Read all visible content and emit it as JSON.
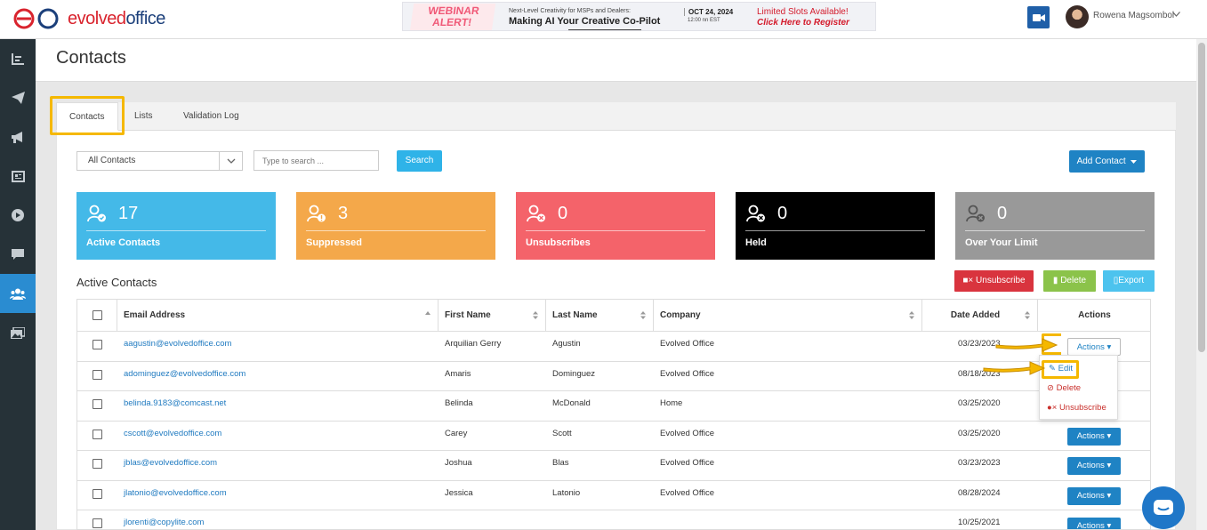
{
  "header": {
    "logo_text_1": "evolved",
    "logo_text_2": "office",
    "banner": {
      "alert_line1": "WEBINAR",
      "alert_line2": "ALERT!",
      "subtitle": "Next-Level Creativity for MSPs and Dealers:",
      "title": "Making AI Your Creative Co-Pilot",
      "date": "OCT 24, 2024",
      "time": "12:00 nn EST",
      "slots": "Limited Slots Available!",
      "cta": "Click Here to Register"
    },
    "user_name": "Rowena Magsombol"
  },
  "sidebar": {
    "items": [
      {
        "icon": "reports-icon"
      },
      {
        "icon": "paper-plane-icon"
      },
      {
        "icon": "megaphone-icon"
      },
      {
        "icon": "newspaper-icon"
      },
      {
        "icon": "play-icon"
      },
      {
        "icon": "chat-icon"
      },
      {
        "icon": "users-icon",
        "active": true
      },
      {
        "icon": "images-icon"
      }
    ]
  },
  "page": {
    "title": "Contacts",
    "tabs": [
      "Contacts",
      "Lists",
      "Validation Log"
    ]
  },
  "filters": {
    "selected": "All Contacts",
    "search_placeholder": "Type to search ...",
    "search_label": "Search",
    "add_contact_label": "Add Contact"
  },
  "stats": [
    {
      "value": "17",
      "label": "Active Contacts",
      "color": "#44b9e8"
    },
    {
      "value": "3",
      "label": "Suppressed",
      "color": "#f4a84a"
    },
    {
      "value": "0",
      "label": "Unsubscribes",
      "color": "#f4636a"
    },
    {
      "value": "0",
      "label": "Held",
      "color": "#000000"
    },
    {
      "value": "0",
      "label": "Over Your Limit",
      "color": "#999999"
    }
  ],
  "section": {
    "title": "Active Contacts",
    "unsubscribe_label": "Unsubscribe",
    "delete_label": "Delete",
    "export_label": "Export"
  },
  "table": {
    "headers": [
      "Email Address",
      "First Name",
      "Last Name",
      "Company",
      "Date Added",
      "Actions"
    ],
    "rows": [
      {
        "email": "aagustin@evolvedoffice.com",
        "first": "Arquilian Gerry",
        "last": "Agustin",
        "company": "Evolved Office",
        "date": "03/23/2023"
      },
      {
        "email": "adominguez@evolvedoffice.com",
        "first": "Amaris",
        "last": "Dominguez",
        "company": "Evolved Office",
        "date": "08/18/2023"
      },
      {
        "email": "belinda.9183@comcast.net",
        "first": "Belinda",
        "last": "McDonald",
        "company": "Home",
        "date": "03/25/2020"
      },
      {
        "email": "cscott@evolvedoffice.com",
        "first": "Carey",
        "last": "Scott",
        "company": "Evolved Office",
        "date": "03/25/2020"
      },
      {
        "email": "jblas@evolvedoffice.com",
        "first": "Joshua",
        "last": "Blas",
        "company": "Evolved Office",
        "date": "03/23/2023"
      },
      {
        "email": "jlatonio@evolvedoffice.com",
        "first": "Jessica",
        "last": "Latonio",
        "company": "Evolved Office",
        "date": "08/28/2024"
      },
      {
        "email": "jlorenti@copylite.com",
        "first": "",
        "last": "",
        "company": "",
        "date": "10/25/2021"
      }
    ],
    "actions_label": "Actions",
    "dropdown": [
      "Edit",
      "Delete",
      "Unsubscribe"
    ]
  }
}
